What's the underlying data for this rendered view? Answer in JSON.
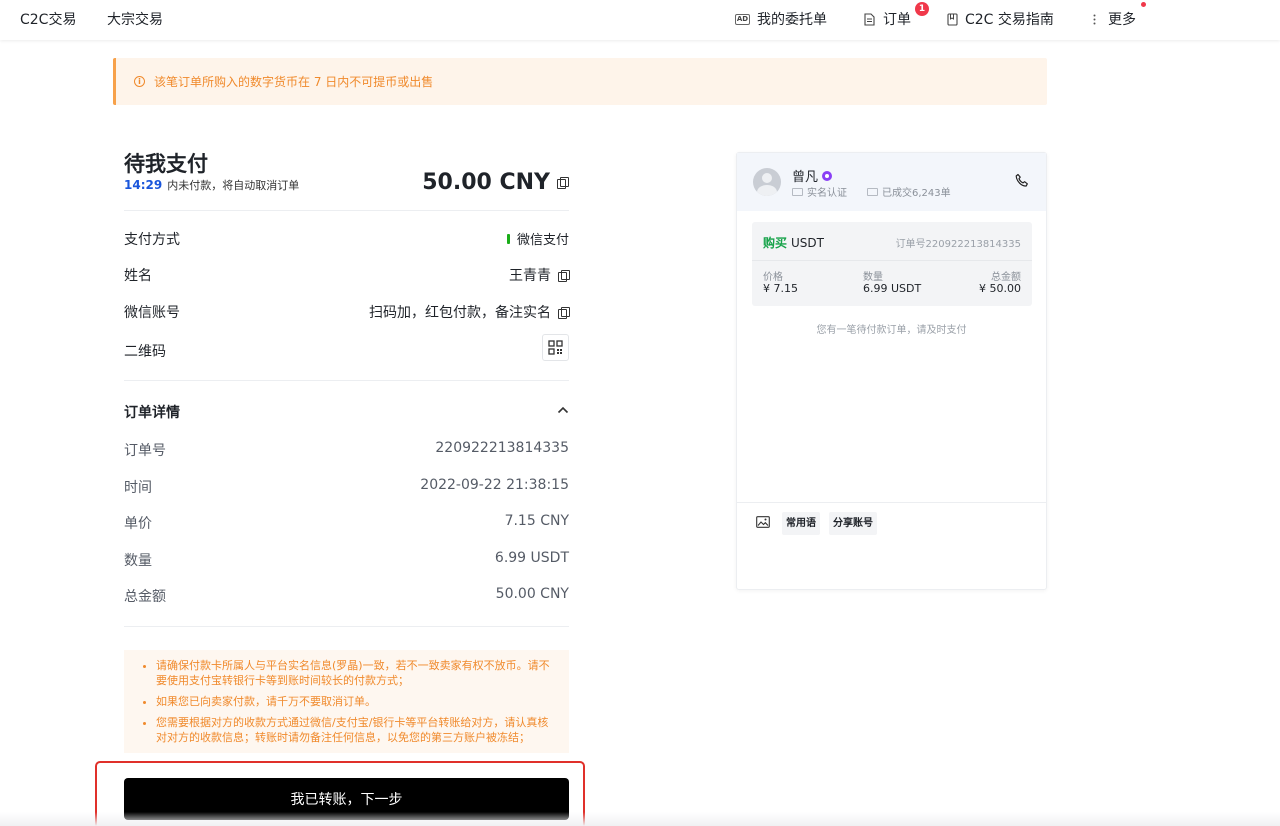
{
  "nav": {
    "c2c": "C2C交易",
    "bulk": "大宗交易",
    "ad_icon": "AD",
    "my_orders": "我的委托单",
    "orders": "订单",
    "orders_badge": "1",
    "guide": "C2C 交易指南",
    "more": "更多"
  },
  "banner": {
    "icon": "info-icon",
    "text": "该笔订单所购入的数字货币在 7 日内不可提币或出售"
  },
  "payment": {
    "title": "待我支付",
    "countdown": "14:29",
    "countdown_text": "内未付款，将自动取消订单",
    "amount": "50.00 CNY",
    "method_label": "支付方式",
    "method_value": "微信支付",
    "name_label": "姓名",
    "name_value": "王青青",
    "account_label": "微信账号",
    "account_value": "扫码加，红包付款，备注实名",
    "qr_label": "二维码"
  },
  "details": {
    "title": "订单详情",
    "rows": [
      {
        "label": "订单号",
        "value": "220922213814335"
      },
      {
        "label": "时间",
        "value": "2022-09-22 21:38:15"
      },
      {
        "label": "单价",
        "value": "7.15 CNY"
      },
      {
        "label": "数量",
        "value": "6.99 USDT"
      },
      {
        "label": "总金额",
        "value": "50.00 CNY"
      }
    ]
  },
  "tips": [
    "请确保付款卡所属人与平台实名信息(罗晶)一致，若不一致卖家有权不放币。请不要使用支付宝转银行卡等到账时间较长的付款方式；",
    "如果您已向卖家付款，请千万不要取消订单。",
    "您需要根据对方的收款方式通过微信/支付宝/银行卡等平台转账给对方，请认真核对对方的收款信息；转账时请勿备注任何信息，以免您的第三方账户被冻结；"
  ],
  "confirm_button": "我已转账，下一步",
  "chat": {
    "seller_name": "曾凡",
    "verified": "实名认证",
    "deals": "已成交6,243单",
    "buy_label": "购买",
    "asset": "USDT",
    "order_no": "订单号220922213814335",
    "price_label": "价格",
    "price_value": "¥ 7.15",
    "qty_label": "数量",
    "qty_value": "6.99 USDT",
    "total_label": "总金额",
    "total_value": "¥ 50.00",
    "hint": "您有一笔待付款订单，请及时支付",
    "quick_phrases": "常用语",
    "share_account": "分享账号"
  },
  "colors": {
    "accent_blue": "#1a56db",
    "warning_orange": "#f08a2c",
    "buy_green": "#17a34a",
    "badge_red": "#f0384a",
    "highlight_red": "#e0302a"
  }
}
